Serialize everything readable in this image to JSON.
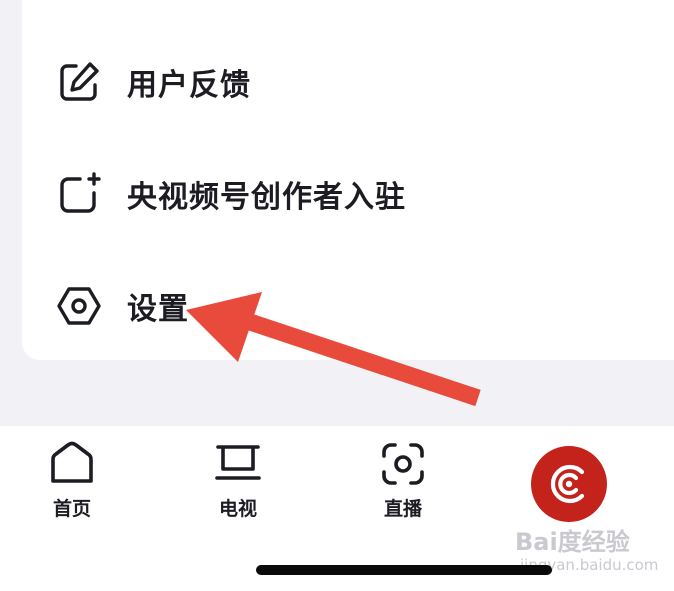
{
  "menu": {
    "items": [
      {
        "label": "用户反馈",
        "icon": "edit-square-icon"
      },
      {
        "label": "央视频号创作者入驻",
        "icon": "add-square-icon"
      },
      {
        "label": "设置",
        "icon": "hexagon-settings-icon"
      }
    ]
  },
  "tabbar": {
    "tabs": [
      {
        "label": "首页",
        "icon": "home-icon"
      },
      {
        "label": "电视",
        "icon": "tv-icon"
      },
      {
        "label": "直播",
        "icon": "live-scan-icon"
      },
      {
        "label": "",
        "icon": "cctv-logo-icon",
        "active": true
      }
    ]
  },
  "watermark": {
    "main": "Bai度经验",
    "sub": "jingyan.baidu.com"
  },
  "annotation": {
    "type": "red-arrow",
    "points_to": "设置",
    "color": "#e84b3c"
  },
  "colors": {
    "background": "#f2f2f6",
    "card": "#ffffff",
    "text": "#1c1c22",
    "accent_red": "#c4231b"
  }
}
